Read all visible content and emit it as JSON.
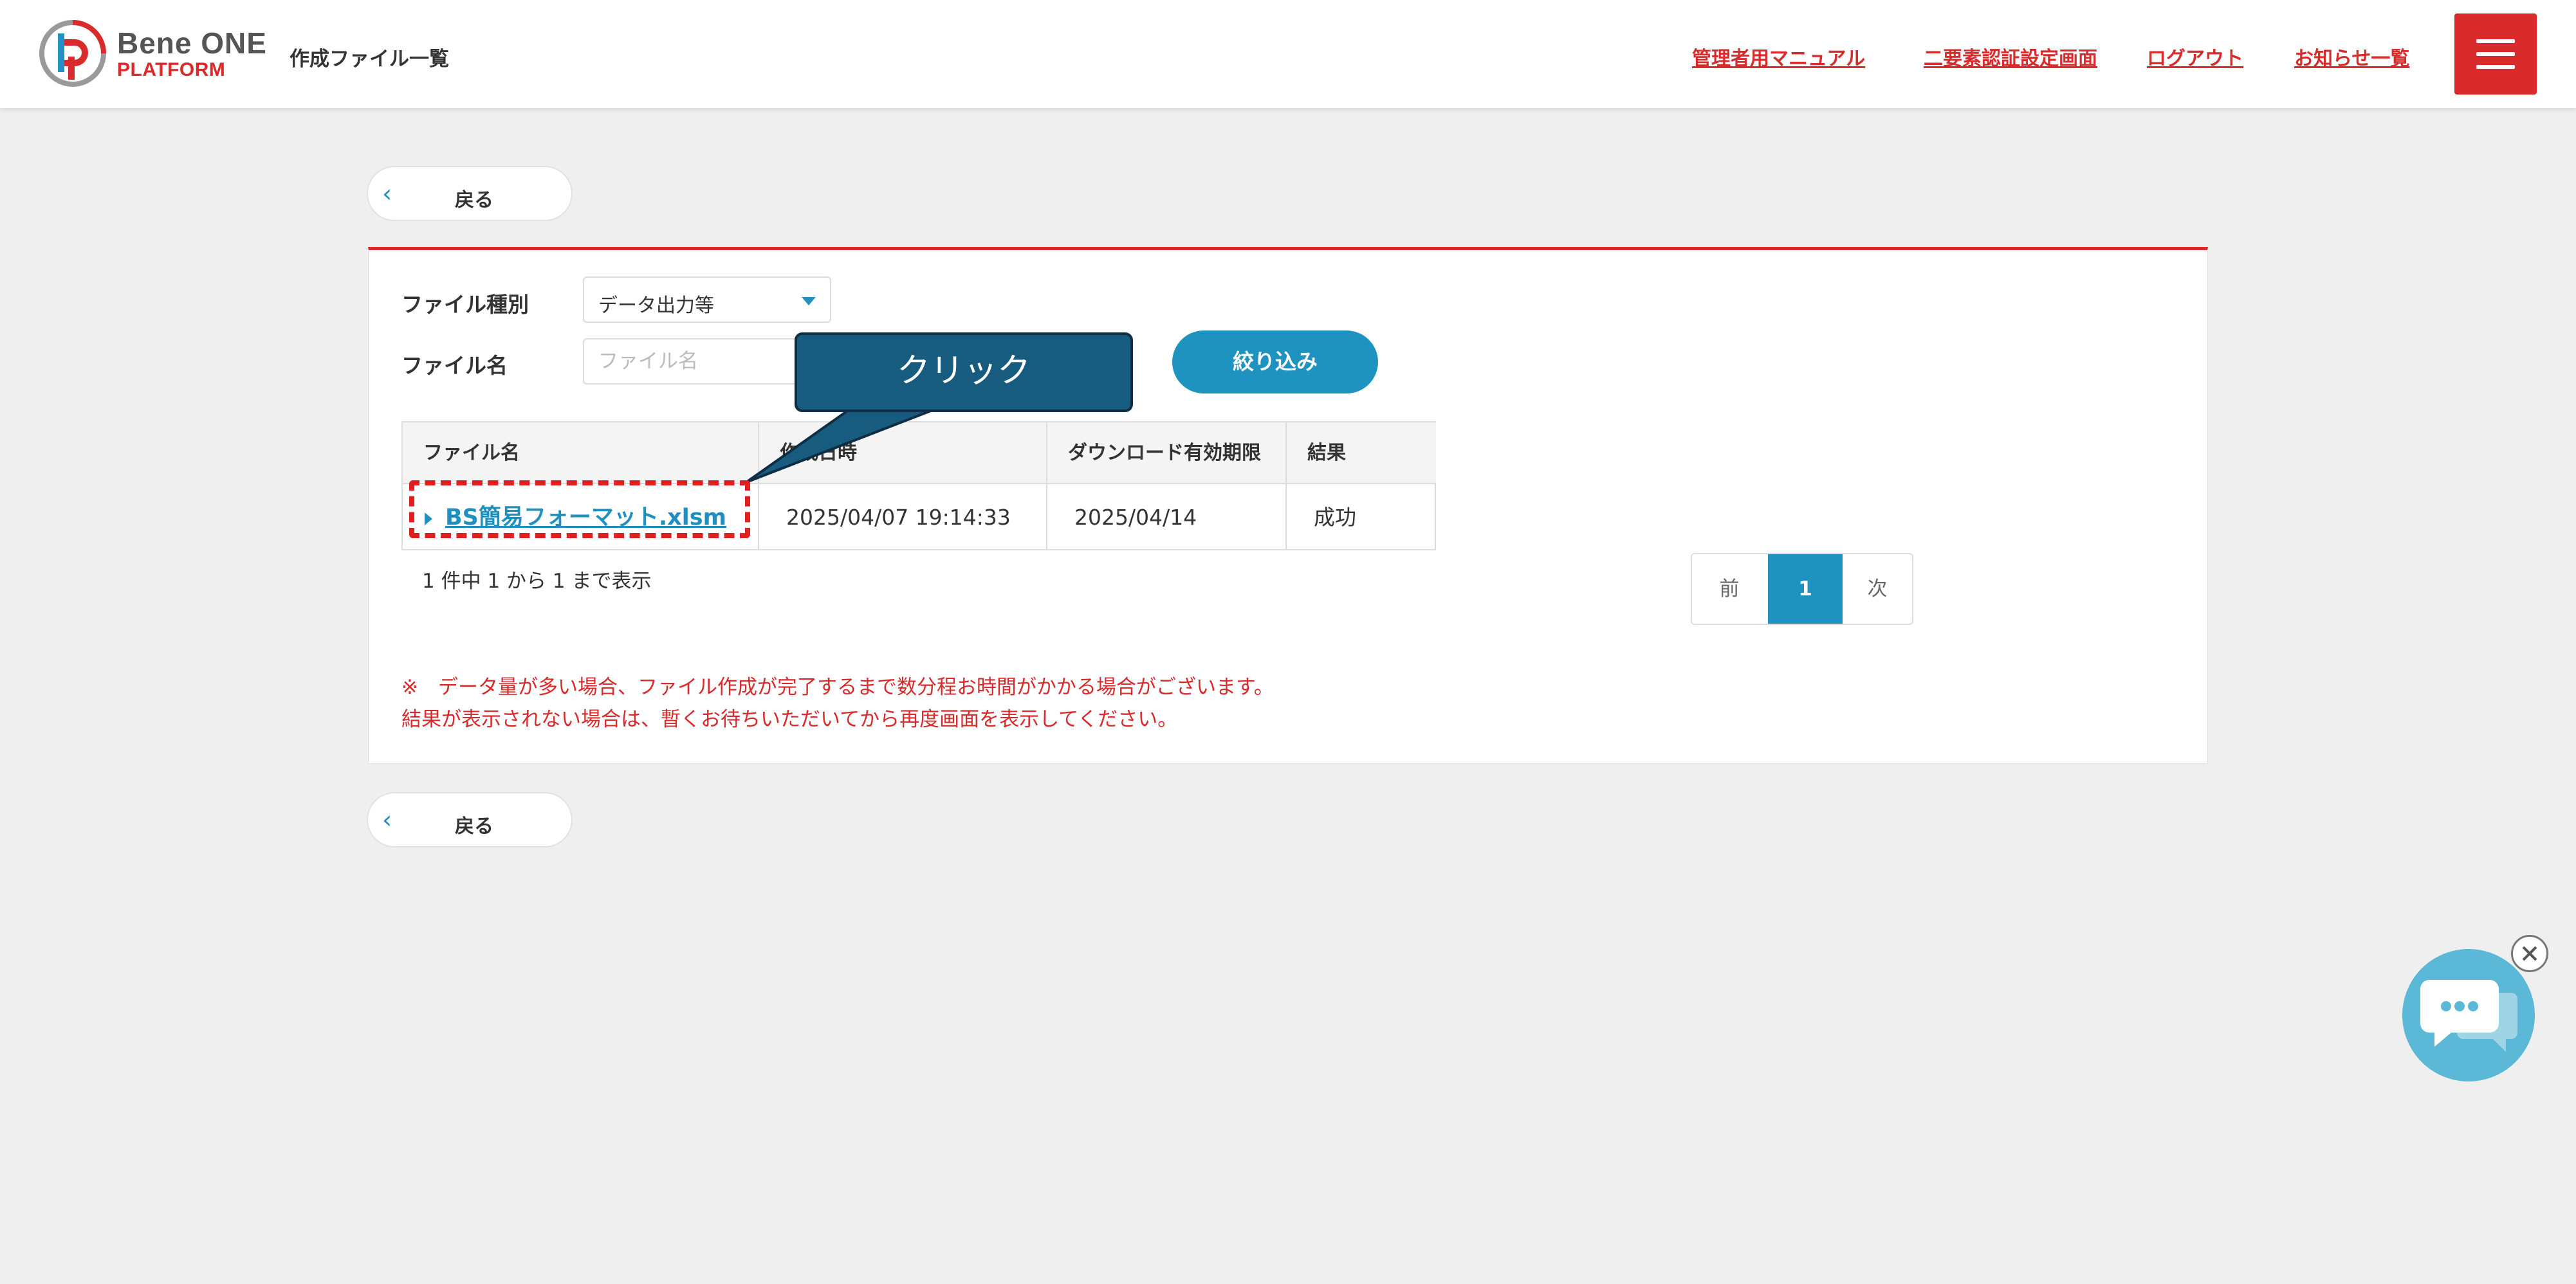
{
  "header": {
    "logo_line1": "Bene ONE",
    "logo_line2": "PLATFORM",
    "page_title": "作成ファイル一覧",
    "nav": {
      "manual": "管理者用マニュアル",
      "two_factor": "二要素認証設定画面",
      "logout": "ログアウト",
      "notices": "お知らせ一覧"
    },
    "menu_icon": "hamburger-icon",
    "brand_red": "#d92b2b"
  },
  "back_button": {
    "label": "戻る",
    "icon": "chevron-left-icon"
  },
  "filters": {
    "file_type_label": "ファイル種別",
    "file_type_value": "データ出力等",
    "file_name_label": "ファイル名",
    "file_name_placeholder": "ファイル名",
    "filter_button": "絞り込み",
    "accent": "#1f93c0"
  },
  "table": {
    "headers": [
      "ファイル名",
      "作成日時",
      "ダウンロード有効期限",
      "結果"
    ],
    "rows": [
      {
        "file_name": "BS簡易フォーマット.xlsm",
        "created_at": "2025/04/07 19:14:33",
        "expires": "2025/04/14",
        "result": "成功"
      }
    ]
  },
  "count_text": "1 件中 1 から 1 まで表示",
  "pagination": {
    "prev": "前",
    "current": "1",
    "next": "次"
  },
  "notes": {
    "line1": "※　データ量が多い場合、ファイル作成が完了するまで数分程お時間がかかる場合がございます。",
    "line2": "結果が表示されない場合は、暫くお待ちいただいてから再度画面を表示してください。"
  },
  "annotation": {
    "callout_text": "クリック"
  },
  "chat_widget": {
    "icon": "chat-bubble-icon",
    "close_icon": "close-icon"
  }
}
